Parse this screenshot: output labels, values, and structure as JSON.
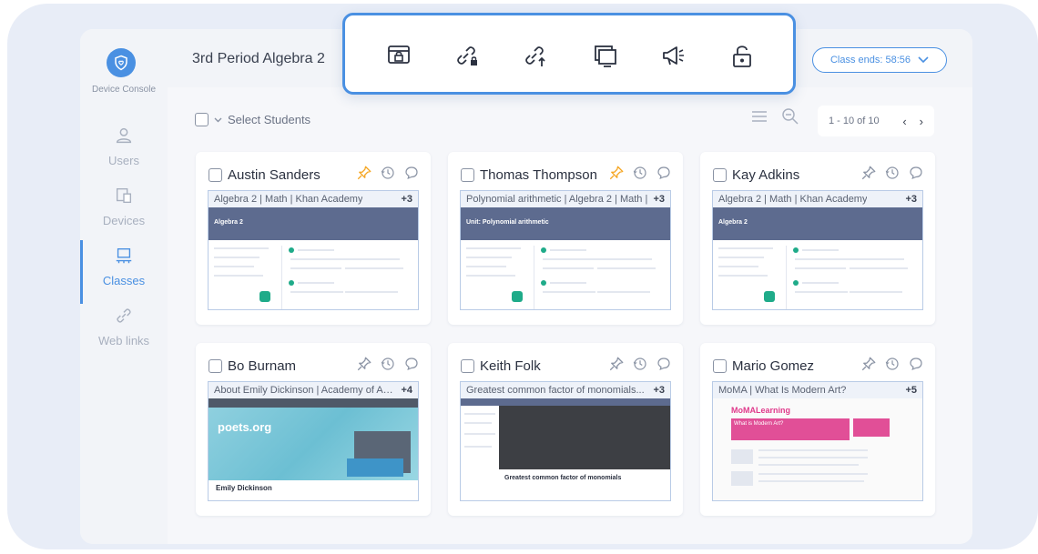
{
  "brand": "Device Console",
  "header": {
    "title": "3rd Period Algebra 2"
  },
  "class_ends": "Class ends: 58:56",
  "sidebar": {
    "items": [
      {
        "label": "Users"
      },
      {
        "label": "Devices"
      },
      {
        "label": "Classes",
        "active": true
      },
      {
        "label": "Web links"
      }
    ]
  },
  "toolbar": {
    "actions": [
      "lock-screen-icon",
      "lock-links-icon",
      "share-link-icon",
      "screen-view-icon",
      "announce-icon",
      "unlock-icon"
    ]
  },
  "select_students": "Select Students",
  "pagination": "1 - 10 of 10",
  "accent": "#4a90e2",
  "pin_active_color": "#f5a623",
  "students": [
    {
      "name": "Austin Sanders",
      "tab": "Algebra 2 | Math | Khan Academy",
      "count": "+3",
      "pinned": true,
      "page_title": "Algebra 2",
      "page_kind": "khan"
    },
    {
      "name": "Thomas Thompson",
      "tab": "Polynomial arithmetic | Algebra 2 | Math |",
      "count": "+3",
      "pinned": true,
      "page_title": "Unit: Polynomial arithmetic",
      "page_kind": "khan"
    },
    {
      "name": "Kay Adkins",
      "tab": "Algebra 2 | Math | Khan Academy",
      "count": "+3",
      "pinned": false,
      "page_title": "Algebra 2",
      "page_kind": "khan"
    },
    {
      "name": "Bo Burnam",
      "tab": "About Emily Dickinson | Academy of Am...",
      "count": "+4",
      "pinned": false,
      "page_title": "poets.org",
      "page_sub": "Emily Dickinson",
      "page_kind": "poets"
    },
    {
      "name": "Keith Folk",
      "tab": "Greatest common factor of monomials...",
      "count": "+3",
      "pinned": false,
      "page_title": "Greatest common factor of monomials",
      "page_kind": "video"
    },
    {
      "name": "Mario Gomez",
      "tab": "MoMA | What Is Modern Art?",
      "count": "+5",
      "pinned": false,
      "page_title": "MoMALearning",
      "page_sub": "What is Modern Art?",
      "page_kind": "moma"
    }
  ]
}
